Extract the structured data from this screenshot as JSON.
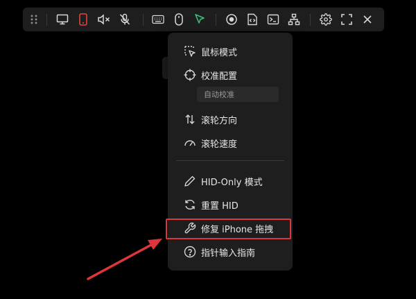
{
  "toolbar": {
    "buttons": [
      {
        "icon": "drag-handle-icon"
      },
      {
        "icon": "monitor-icon"
      },
      {
        "icon": "phone-icon",
        "active_color": "#e0453f"
      },
      {
        "icon": "speaker-muted-icon"
      },
      {
        "icon": "mic-off-icon"
      },
      {
        "icon": "keyboard-icon"
      },
      {
        "icon": "mouse-icon"
      },
      {
        "icon": "pointer-icon",
        "active_color": "#3bc07a"
      },
      {
        "icon": "record-icon"
      },
      {
        "icon": "file-code-icon"
      },
      {
        "icon": "terminal-icon"
      },
      {
        "icon": "network-icon"
      },
      {
        "icon": "gear-icon"
      },
      {
        "icon": "fullscreen-icon"
      },
      {
        "icon": "close-icon"
      }
    ]
  },
  "menu": {
    "items": [
      {
        "label": "鼠标模式",
        "icon": "cursor-select-icon"
      },
      {
        "label": "校准配置",
        "icon": "crosshair-icon"
      },
      {
        "label": "滚轮方向",
        "icon": "scroll-direction-icon"
      },
      {
        "label": "滚轮速度",
        "icon": "speedometer-icon"
      },
      {
        "label": "HID-Only 模式",
        "icon": "pencil-icon"
      },
      {
        "label": "重置 HID",
        "icon": "refresh-icon"
      },
      {
        "label": "修复 iPhone 拖拽",
        "icon": "wrench-icon"
      },
      {
        "label": "指针输入指南",
        "icon": "help-circle-icon"
      }
    ],
    "calibration_sub": "自动校准",
    "highlighted_item": "修复 iPhone 拖拽"
  },
  "colors": {
    "background": "#000000",
    "panel": "#1e1e1e",
    "text": "#e6e6e6",
    "highlight": "#e0353a"
  }
}
